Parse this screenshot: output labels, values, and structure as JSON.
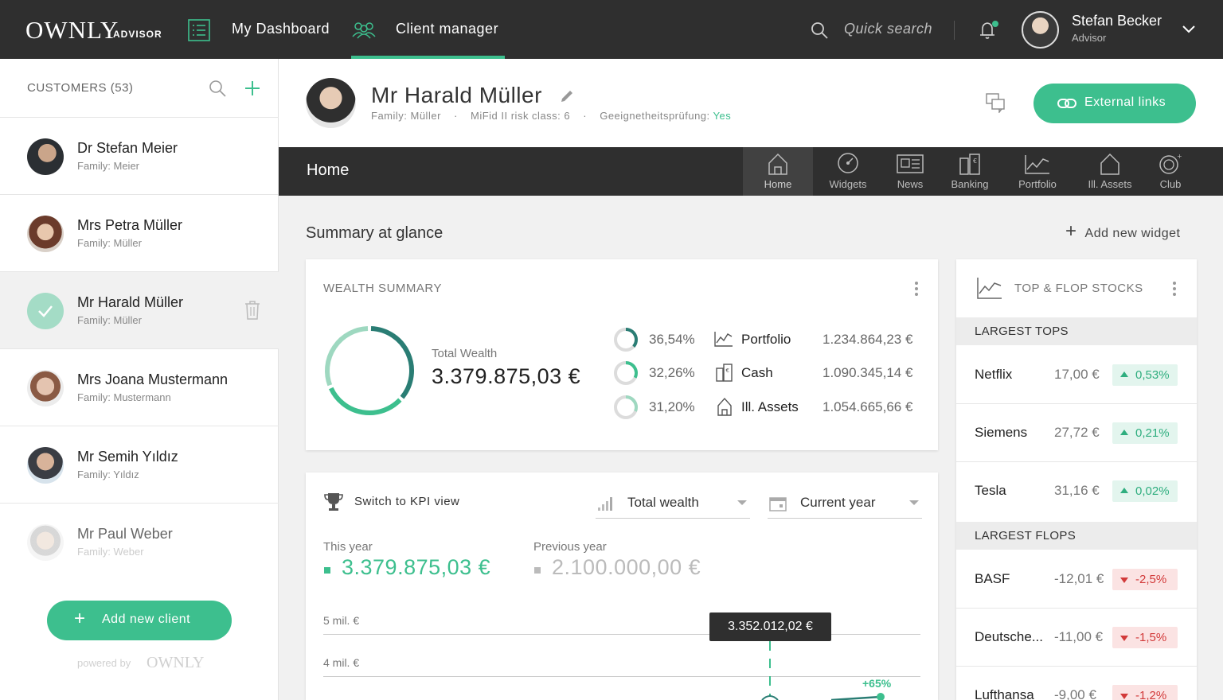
{
  "brand": {
    "name": "OWNLY",
    "sub": "ADVISOR"
  },
  "nav": {
    "dashboard": "My Dashboard",
    "client_manager": "Client manager"
  },
  "search": {
    "placeholder": "Quick search"
  },
  "user": {
    "name": "Stefan Becker",
    "role": "Advisor"
  },
  "sidebar": {
    "title": "CUSTOMERS (53)",
    "customers": [
      {
        "name": "Dr Stefan Meier",
        "family": "Family:  Meier"
      },
      {
        "name": "Mrs Petra Müller",
        "family": "Family:  Müller"
      },
      {
        "name": "Mr Harald Müller",
        "family": "Family:  Müller"
      },
      {
        "name": "Mrs Joana Mustermann",
        "family": "Family:  Mustermann"
      },
      {
        "name": "Mr Semih Yıldız",
        "family": "Family:  Yıldız"
      },
      {
        "name": "Mr Paul Weber",
        "family": "Family:  Weber"
      }
    ],
    "add_client": "Add new client",
    "powered_by": "powered by",
    "powered_logo": "OWNLY"
  },
  "client": {
    "name": "Mr Harald Müller",
    "family": "Family:  Müller",
    "mifid": "MiFid II risk class: 6",
    "suitability_label": "Geeignetheitsprüfung:",
    "suitability_value": "Yes",
    "external_links": "External links"
  },
  "tabbar": {
    "title": "Home",
    "tabs": [
      "Home",
      "Widgets",
      "News",
      "Banking",
      "Portfolio",
      "Ill. Assets",
      "Club"
    ]
  },
  "summary": {
    "title": "Summary at glance",
    "add_widget": "Add new widget"
  },
  "wealth": {
    "title": "WEALTH SUMMARY",
    "total_label": "Total Wealth",
    "total_value": "3.379.875,03 €",
    "allocations": [
      {
        "pct": "36,54%",
        "name": "Portfolio",
        "amount": "1.234.864,23 €",
        "fraction": 0.3654
      },
      {
        "pct": "32,26%",
        "name": "Cash",
        "amount": "1.090.345,14 €",
        "fraction": 0.3226
      },
      {
        "pct": "31,20%",
        "name": "Ill. Assets",
        "amount": "1.054.665,66 €",
        "fraction": 0.312
      }
    ]
  },
  "kpi": {
    "switch": "Switch to KPI view",
    "metric": "Total wealth",
    "period": "Current year",
    "this_year_label": "This year",
    "this_year_value": "3.379.875,03 €",
    "prev_year_label": "Previous year",
    "prev_year_value": "2.100.000,00 €",
    "gridlines": [
      "5 mil. €",
      "4 mil. €"
    ],
    "tooltip": "3.352.012,02 €",
    "growth": "+65%"
  },
  "stocks": {
    "title": "TOP & FLOP STOCKS",
    "tops_label": "LARGEST TOPS",
    "tops": [
      {
        "name": "Netflix",
        "price": "17,00 €",
        "change": "0,53%"
      },
      {
        "name": "Siemens",
        "price": "27,72 €",
        "change": "0,21%"
      },
      {
        "name": "Tesla",
        "price": "31,16 €",
        "change": "0,02%"
      }
    ],
    "flops_label": "LARGEST FLOPS",
    "flops": [
      {
        "name": "BASF",
        "price": "-12,01 €",
        "change": "-2,5%"
      },
      {
        "name": "Deutsche...",
        "price": "-11,00 €",
        "change": "-1,5%"
      },
      {
        "name": "Lufthansa",
        "price": "-9,00 €",
        "change": "-1,2%"
      }
    ]
  },
  "colors": {
    "accent": "#3dbf8e",
    "dark": "#2f2f2f",
    "ring_dark": "#2a7d74",
    "down": "#d23a3a"
  }
}
